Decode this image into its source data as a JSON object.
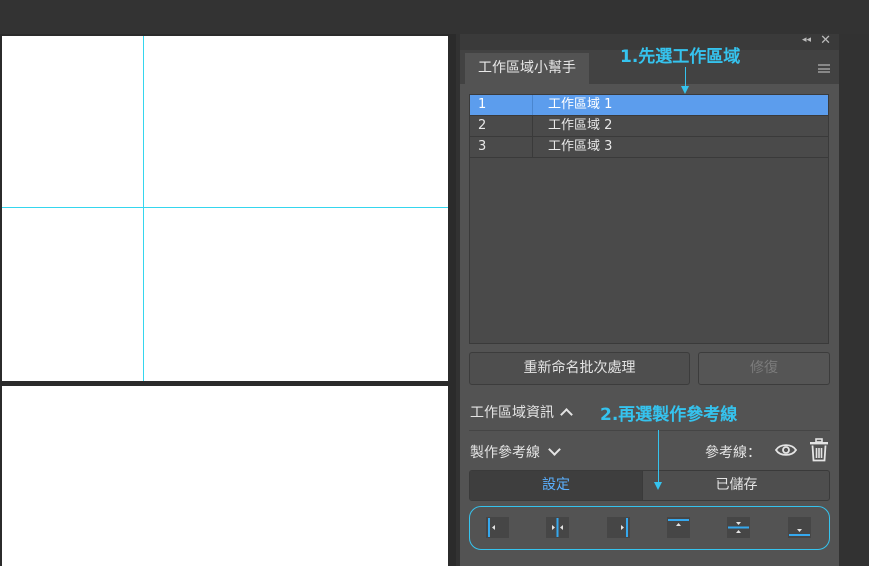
{
  "panel": {
    "tab_title": "工作區域小幫手",
    "artboards": [
      {
        "num": "1",
        "name": "工作區域 1",
        "selected": true
      },
      {
        "num": "2",
        "name": "工作區域 2",
        "selected": false
      },
      {
        "num": "3",
        "name": "工作區域 3",
        "selected": false
      }
    ],
    "rename_button": "重新命名批次處理",
    "repair_button": "修復",
    "info_section": "工作區域資訊",
    "guide_section": "製作參考線",
    "guide_label": "參考線：",
    "segment": {
      "set": "設定",
      "saved": "已儲存"
    },
    "align_buttons": [
      "guide-left",
      "guide-center-vertical",
      "guide-right",
      "guide-top",
      "guide-center-horizontal",
      "guide-bottom"
    ]
  },
  "annotations": {
    "step1": "1.先選工作區域",
    "step2": "2.再選製作參考線"
  },
  "colors": {
    "accent": "#35c3ee",
    "selection": "#5c9ded",
    "guide": "#35d6ee",
    "active_text": "#5ab0ff"
  }
}
